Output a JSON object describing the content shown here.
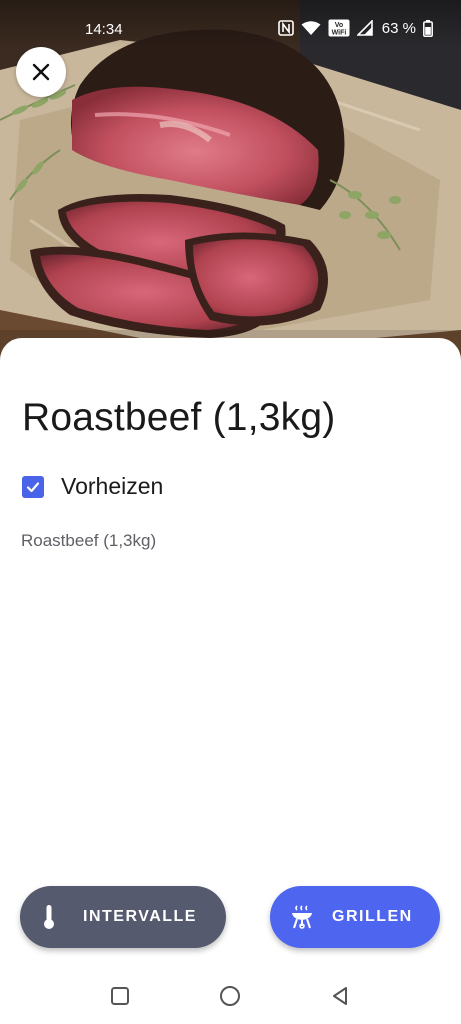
{
  "status_bar": {
    "time": "14:34",
    "battery_percent": "63 %",
    "icons": [
      "nfc-icon",
      "wifi-icon",
      "vowifi-icon",
      "signal-icon",
      "battery-icon"
    ],
    "vowifi_top": "Vo",
    "vowifi_bottom": "WiFi"
  },
  "hero": {
    "image_subject": "roast-beef-photo"
  },
  "recipe": {
    "title": "Roastbeef (1,3kg)",
    "preheat_label": "Vorheizen",
    "preheat_checked": true,
    "subtitle": "Roastbeef (1,3kg)"
  },
  "actions": {
    "intervalle_label": "INTERVALLE",
    "grillen_label": "GRILLEN"
  },
  "colors": {
    "accent": "#4e65ef",
    "checkbox": "#4a63e8",
    "secondary_button": "#565a6e",
    "title_text": "#1a1a1a",
    "subtitle_text": "#5f5f66"
  },
  "nav": {
    "icons": [
      "recents-icon",
      "home-icon",
      "back-icon"
    ]
  }
}
